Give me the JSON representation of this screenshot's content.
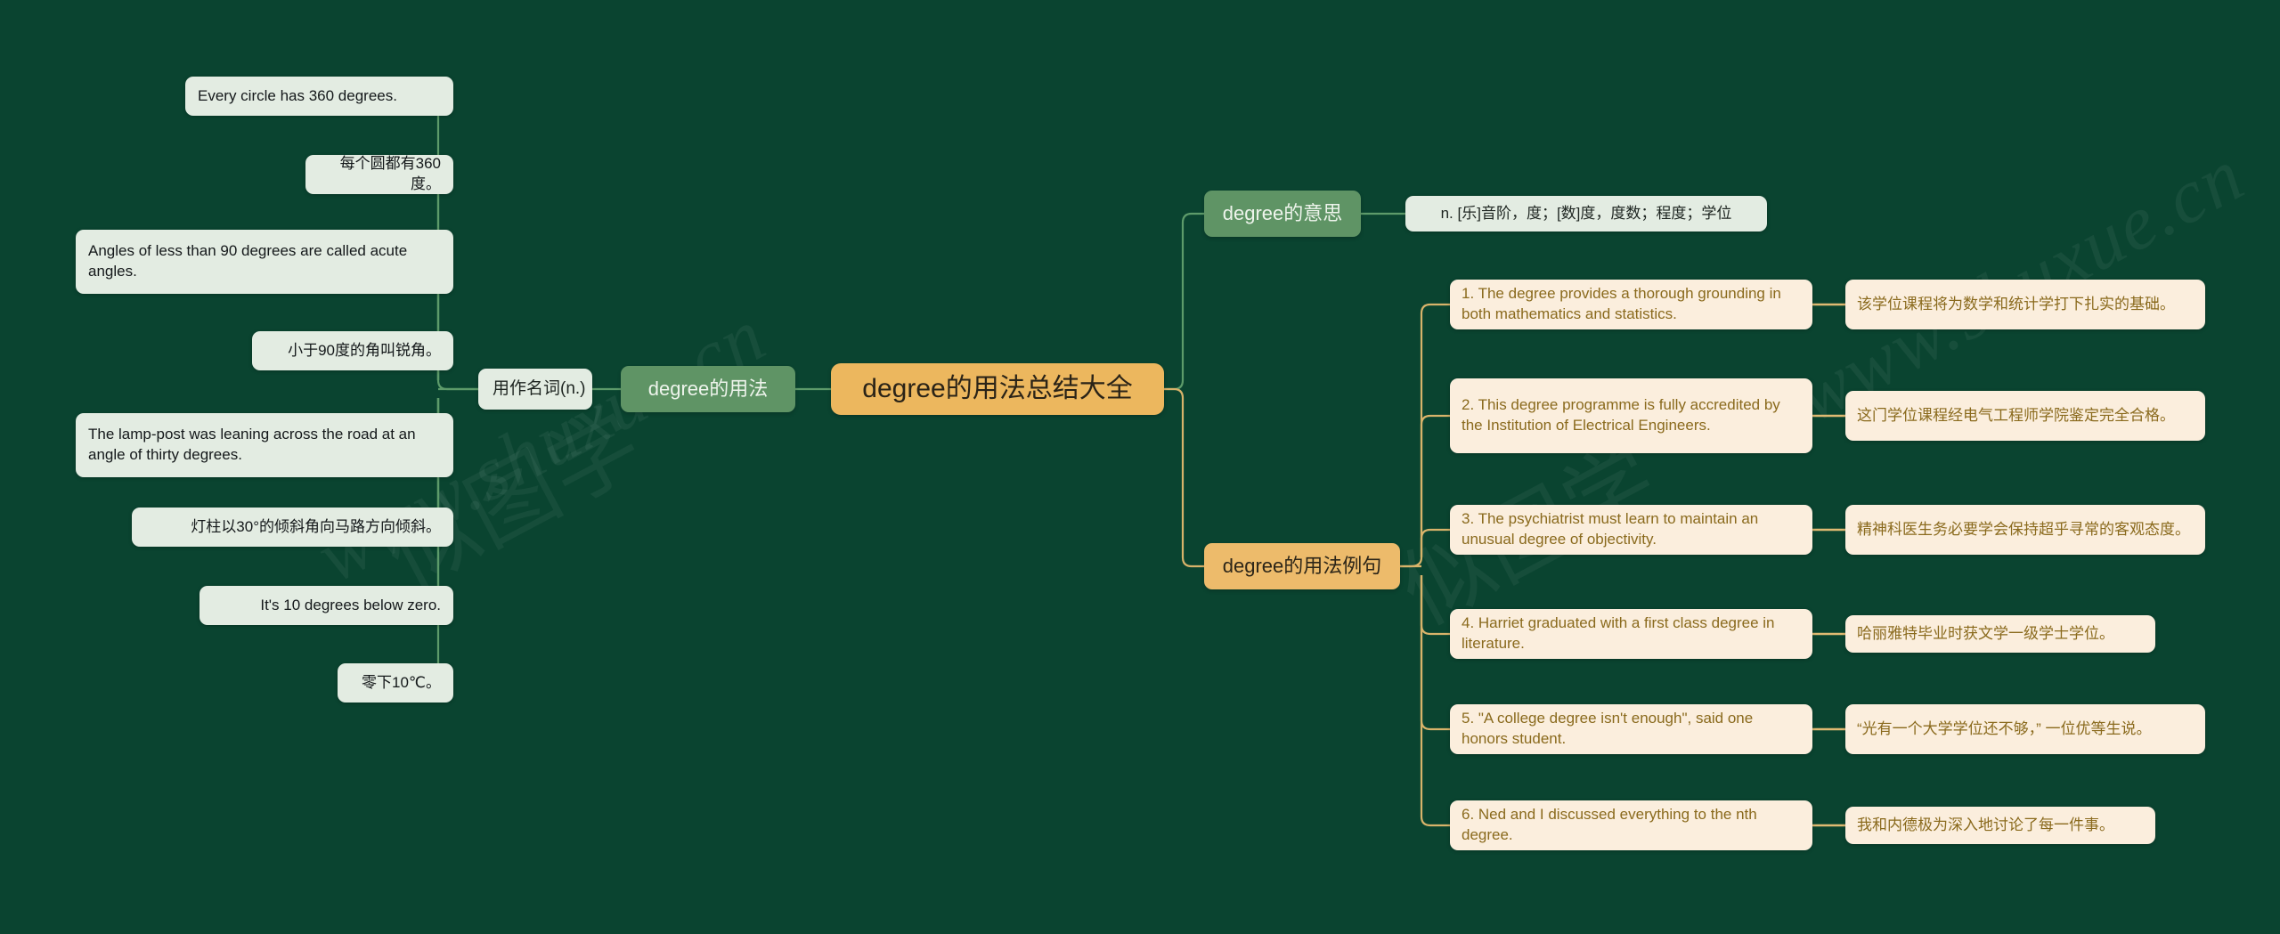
{
  "theme": {
    "background": "#0a4430",
    "root_fill": "#ecb75e",
    "branch_green_fill": "#5f9465",
    "branch_gold_fill": "#edbb6b",
    "leaf_mint_fill": "#e3ece2",
    "leaf_cream_fill": "#fbeedd",
    "link_green": "#5d9b6a",
    "link_gold": "#d8b36a",
    "cream_text": "#8a6a1d"
  },
  "root": {
    "label": "degree的用法总结大全"
  },
  "branches": {
    "usage": {
      "label": "degree的用法",
      "sub": {
        "label": "用作名词(n.)",
        "leaves": [
          {
            "id": "en-1",
            "text": "Every circle has 360 degrees."
          },
          {
            "id": "zh-1",
            "text": "每个圆都有360度。"
          },
          {
            "id": "en-2",
            "text": "Angles of less than 90 degrees are called acute angles."
          },
          {
            "id": "zh-2",
            "text": "小于90度的角叫锐角。"
          },
          {
            "id": "en-3",
            "text": "The lamp-post was leaning across the road at an angle of thirty degrees."
          },
          {
            "id": "zh-3",
            "text": "灯柱以30°的倾斜角向马路方向倾斜。"
          },
          {
            "id": "en-4",
            "text": "It's 10 degrees below zero."
          },
          {
            "id": "zh-4",
            "text": "零下10℃。"
          }
        ]
      }
    },
    "meaning": {
      "label": "degree的意思",
      "definition": "n. [乐]音阶，度；[数]度，度数；程度；学位"
    },
    "examples": {
      "label": "degree的用法例句",
      "items": [
        {
          "en": "1. The degree provides a thorough grounding in both mathematics and statistics.",
          "zh": "该学位课程将为数学和统计学打下扎实的基础。"
        },
        {
          "en": "2. This degree programme is fully accredited by the Institution of Electrical Engineers.",
          "zh": "这门学位课程经电气工程师学院鉴定完全合格。"
        },
        {
          "en": "3. The psychiatrist must learn to maintain an unusual degree of objectivity.",
          "zh": "精神科医生务必要学会保持超乎寻常的客观态度。"
        },
        {
          "en": "4. Harriet graduated with a first class degree in literature.",
          "zh": "哈丽雅特毕业时获文学一级学士学位。"
        },
        {
          "en": "5. \"A college degree isn't enough\", said one honors student.",
          "zh": "“光有一个大学学位还不够，” 一位优等生说。"
        },
        {
          "en": "6. Ned and I discussed everything to the nth degree.",
          "zh": "我和内德极为深入地讨论了每一件事。"
        }
      ]
    }
  },
  "watermarks": [
    {
      "id": "wm-1",
      "text": "www.shuxue.cn"
    },
    {
      "id": "wm-2",
      "text": "www.shuxue.cn"
    },
    {
      "id": "wm-3",
      "text": "似图学"
    },
    {
      "id": "wm-4",
      "text": "似图学"
    }
  ]
}
